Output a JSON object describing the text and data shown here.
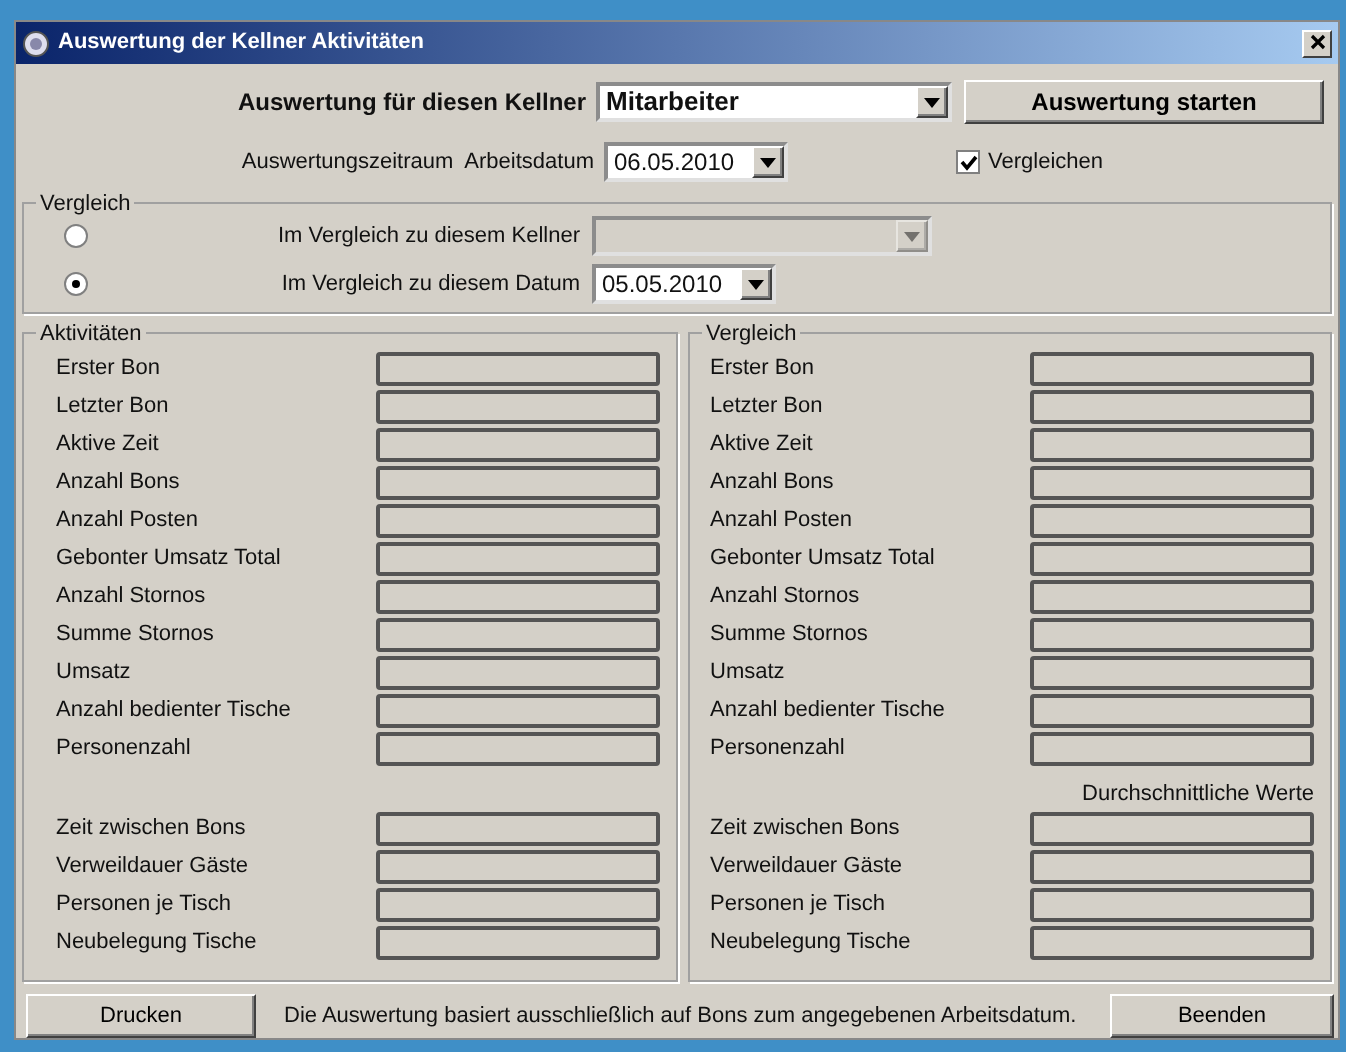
{
  "window": {
    "title": "Auswertung der Kellner Aktivitäten"
  },
  "kellner": {
    "label": "Auswertung für diesen Kellner",
    "value": "Mitarbeiter"
  },
  "start_button": "Auswertung starten",
  "zeitraum": {
    "label": "Auswertungszeitraum  Arbeitsdatum",
    "value": "06.05.2010"
  },
  "vergleichen": {
    "label": "Vergleichen",
    "checked": true
  },
  "vergleich": {
    "title": "Vergleich",
    "options": [
      {
        "label": "Im Vergleich zu diesem Kellner",
        "selected": false,
        "disabled": true
      },
      {
        "label": "Im Vergleich zu diesem Datum",
        "selected": true,
        "disabled": false,
        "value": "05.05.2010"
      }
    ]
  },
  "panels": [
    {
      "title": "Aktivitäten",
      "rows": [
        "Erster Bon",
        "Letzter Bon",
        "Aktive Zeit",
        "Anzahl Bons",
        "Anzahl Posten",
        "Gebonter Umsatz Total",
        "Anzahl Stornos",
        "Summe Stornos",
        "Umsatz",
        "Anzahl bedienter Tische",
        "Personenzahl"
      ],
      "average_rows": [
        "Zeit zwischen Bons",
        "Verweildauer  Gäste",
        "Personen je Tisch",
        "Neubelegung Tische"
      ]
    },
    {
      "title": "Vergleich",
      "rows": [
        "Erster Bon",
        "Letzter Bon",
        "Aktive Zeit",
        "Anzahl Bons",
        "Anzahl Posten",
        "Gebonter Umsatz Total",
        "Anzahl Stornos",
        "Summe Stornos",
        "Umsatz",
        "Anzahl bedienter Tische",
        "Personenzahl"
      ],
      "average_label": "Durchschnittliche Werte",
      "average_rows": [
        "Zeit zwischen Bons",
        "Verweildauer  Gäste",
        "Personen je Tisch",
        "Neubelegung Tische"
      ]
    }
  ],
  "footer": {
    "print_button": "Drucken",
    "note": "Die Auswertung basiert ausschließlich auf Bons zum angegebenen Arbeitsdatum.",
    "close_button": "Beenden"
  }
}
